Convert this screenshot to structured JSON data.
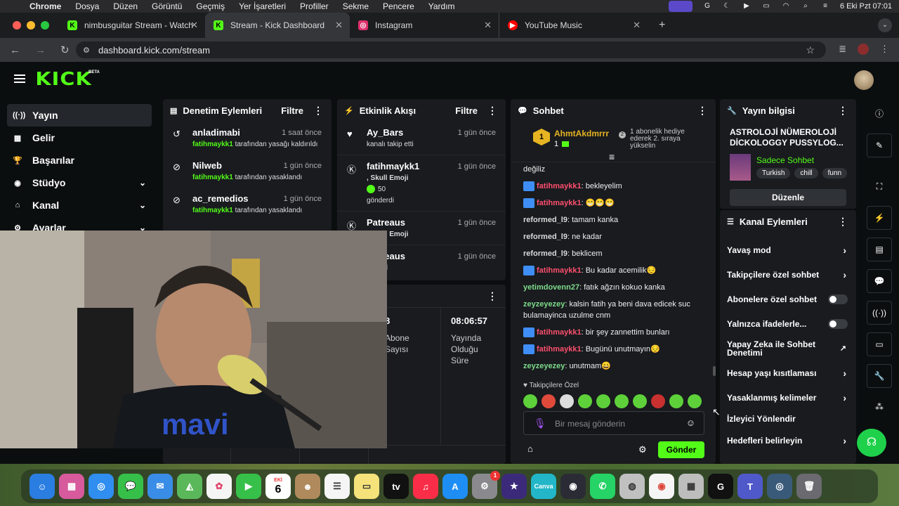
{
  "menubar": {
    "app": "Chrome",
    "items": [
      "Dosya",
      "Düzen",
      "Görüntü",
      "Geçmiş",
      "Yer İşaretleri",
      "Profiller",
      "Sekme",
      "Pencere",
      "Yardım"
    ],
    "datetime": "6 Eki Pzt 07:01"
  },
  "tabs": [
    {
      "title": "nimbusguitar Stream - Watch",
      "fav": "K",
      "favcolor": "#53fc18"
    },
    {
      "title": "Stream - Kick Dashboard",
      "fav": "K",
      "favcolor": "#53fc18"
    },
    {
      "title": "Instagram",
      "fav": "◎",
      "favcolor": "#e1306c"
    },
    {
      "title": "YouTube Music",
      "fav": "▶",
      "favcolor": "#ff0000"
    }
  ],
  "address": {
    "url": "dashboard.kick.com/stream"
  },
  "brand": {
    "logo": "KICK",
    "beta": "BETA",
    "accent": "#53fc18"
  },
  "sidebar": {
    "items": [
      {
        "label": "Yayın",
        "icon": "broadcast-icon"
      },
      {
        "label": "Gelir",
        "icon": "chart-icon"
      },
      {
        "label": "Başarılar",
        "icon": "trophy-icon"
      },
      {
        "label": "Stüdyo",
        "icon": "palette-icon"
      },
      {
        "label": "Kanal",
        "icon": "home-icon"
      },
      {
        "label": "Ayarlar",
        "icon": "gear-icon"
      }
    ]
  },
  "moderation": {
    "title": "Denetim Eylemleri",
    "filter": "Filtre",
    "rows": [
      {
        "name": "anladimabi",
        "time": "1 saat önce",
        "actor": "fatihmaykk1",
        "text": " tarafından yasağı kaldırıldı"
      },
      {
        "name": "Nilweb",
        "time": "1 gün önce",
        "actor": "fatihmaykk1",
        "text": " tarafından yasaklandı"
      },
      {
        "name": "ac_remedios",
        "time": "1 gün önce",
        "actor": "fatihmaykk1",
        "text": " tarafından yasaklandı"
      }
    ]
  },
  "activity": {
    "title": "Etkinlik Akışı",
    "filter": "Filtre",
    "rows": [
      {
        "name": "Ay_Bars",
        "time": "1 gün önce",
        "line1": "kanalı takip etti",
        "line2": ""
      },
      {
        "name": "fatihmaykk1",
        "time": "1 gün önce",
        "line1": ", Skull Emoji",
        "line2": "50"
      },
      {
        "name": "Patreaus",
        "time": "1 gün önce",
        "line1": ", Skull Emoji",
        "line2": ""
      },
      {
        "name": "Patreaus",
        "time": "1 gün önce",
        "line1": ", Send",
        "line2": ""
      }
    ],
    "sent": "gönderdi"
  },
  "stats": {
    "time": "08:06:57",
    "time_label": "Yayında Olduğu Süre",
    "sub_label": "Abone Sayısı",
    "sub_value": "8"
  },
  "chat": {
    "title": "Sohbet",
    "pinned_user": "AhmtAkdmrrr",
    "pinned_rank": "1",
    "pinned_count": "1",
    "pinned_info": "1 abonelik hediye ederek 2. sıraya yükselin",
    "first_partial": "değiliz",
    "messages": [
      {
        "user": "fatihmaykk1",
        "color": "#ff4f6d",
        "badge": true,
        "text": ": bekleyelim"
      },
      {
        "user": "fatihmaykk1",
        "color": "#ff4f6d",
        "badge": true,
        "text": ": 😁😁😁"
      },
      {
        "user": "reformed_l9",
        "color": "#d9d9d9",
        "badge": false,
        "text": ": tamam kanka"
      },
      {
        "user": "reformed_l9",
        "color": "#d9d9d9",
        "badge": false,
        "text": ": ne kadar"
      },
      {
        "user": "reformed_l9",
        "color": "#d9d9d9",
        "badge": false,
        "text": ": beklicem"
      },
      {
        "user": "fatihmaykk1",
        "color": "#ff4f6d",
        "badge": true,
        "text": ": Bu kadar acemilik😔"
      },
      {
        "user": "yetimdovenn27",
        "color": "#7ddc8a",
        "badge": false,
        "text": ": fatık ağzın kokuo kanka"
      },
      {
        "user": "zeyzeyezey",
        "color": "#7ddc8a",
        "badge": false,
        "text": ": kalsin fatih ya beni dava edicek suc bulamayinca uzulme cnm"
      },
      {
        "user": "fatihmaykk1",
        "color": "#ff4f6d",
        "badge": true,
        "text": ": bir şey zannettim bunları"
      },
      {
        "user": "fatihmaykk1",
        "color": "#ff4f6d",
        "badge": true,
        "text": ": Bugünü unutmayın😔"
      },
      {
        "user": "zeyzeyezey",
        "color": "#7ddc8a",
        "badge": false,
        "text": ": unutmam😄"
      }
    ],
    "followers_only": "Takipçilere Özel",
    "placeholder": "Bir mesaj gönderin",
    "send": "Gönder"
  },
  "stream_info": {
    "title": "Yayın bilgisi",
    "stream_title": "ASTROLOJİ NÜMEROLOJİ DİCKOLOGGY PUSSYLOG...",
    "category": "Sadece Sohbet",
    "tags": [
      "Turkish",
      "chill",
      "funn"
    ],
    "edit": "Düzenle"
  },
  "channel_actions": {
    "title": "Kanal Eylemleri",
    "items": [
      {
        "label": "Yavaş mod",
        "kind": "chev"
      },
      {
        "label": "Takipçilere özel sohbet",
        "kind": "chev"
      },
      {
        "label": "Abonelere özel sohbet",
        "kind": "toggle"
      },
      {
        "label": "Yalnızca ifadelerle...",
        "kind": "toggle"
      },
      {
        "label": "Yapay Zeka ile Sohbet Denetimi",
        "kind": "ext"
      },
      {
        "label": "Hesap yaşı kısıtlaması",
        "kind": "chev"
      },
      {
        "label": "Yasaklanmış kelimeler",
        "kind": "chev"
      },
      {
        "label": "İzleyici Yönlendir",
        "kind": "none"
      },
      {
        "label": "Hedefleri belirleyin",
        "kind": "chev"
      }
    ]
  },
  "dock": {
    "calendar_month": "EKİ",
    "calendar_day": "6",
    "settings_badge": "1"
  }
}
